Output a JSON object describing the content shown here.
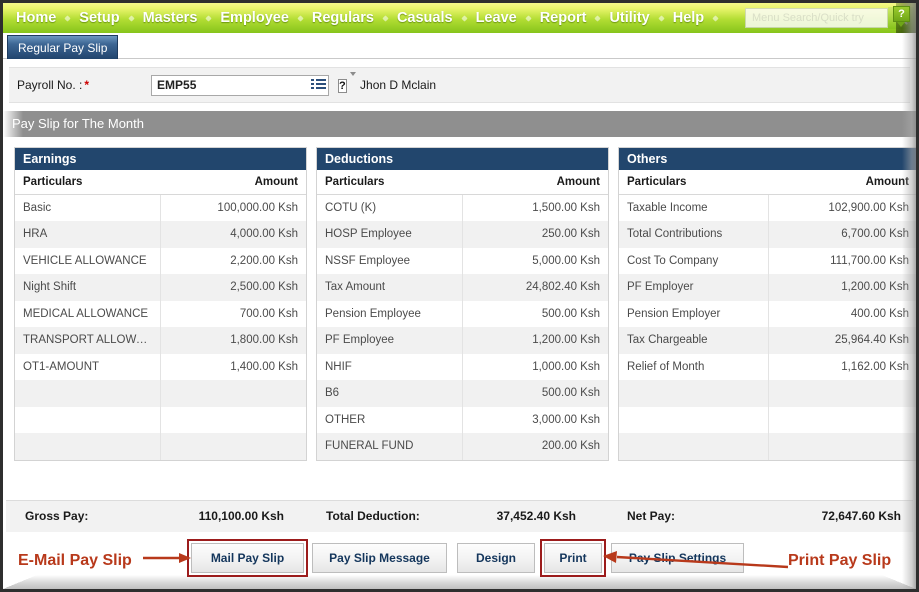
{
  "nav": {
    "items": [
      "Home",
      "Setup",
      "Masters",
      "Employee",
      "Regulars",
      "Casuals",
      "Leave",
      "Report",
      "Utility",
      "Help"
    ],
    "search_placeholder": "Menu Search/Quick try",
    "search_value": "",
    "search_icon": "magnifier-icon"
  },
  "tab": {
    "label": "Regular Pay Slip"
  },
  "help_badge": {
    "glyph": "?"
  },
  "payroll": {
    "label": "Payroll No. :",
    "required_mark": "*",
    "value": "EMP55",
    "picker_icon": "list-picker-icon",
    "help_glyph": "?",
    "employee_name": "Jhon D Mclain"
  },
  "section": {
    "title": "Pay Slip for The Month"
  },
  "columns": {
    "particulars": "Particulars",
    "amount": "Amount"
  },
  "panels": [
    {
      "title": "Earnings",
      "rows": [
        {
          "particular": "Basic",
          "amount": "100,000.00 Ksh"
        },
        {
          "particular": "HRA",
          "amount": "4,000.00 Ksh"
        },
        {
          "particular": "VEHICLE ALLOWANCE",
          "amount": "2,200.00 Ksh"
        },
        {
          "particular": "Night Shift",
          "amount": "2,500.00 Ksh"
        },
        {
          "particular": "MEDICAL ALLOWANCE",
          "amount": "700.00 Ksh"
        },
        {
          "particular": "TRANSPORT ALLOWANCE",
          "amount": "1,800.00 Ksh"
        },
        {
          "particular": "OT1-AMOUNT",
          "amount": "1,400.00 Ksh"
        },
        {
          "particular": "",
          "amount": ""
        },
        {
          "particular": "",
          "amount": ""
        },
        {
          "particular": "",
          "amount": ""
        }
      ]
    },
    {
      "title": "Deductions",
      "rows": [
        {
          "particular": "COTU (K)",
          "amount": "1,500.00 Ksh"
        },
        {
          "particular": "HOSP Employee",
          "amount": "250.00 Ksh"
        },
        {
          "particular": "NSSF Employee",
          "amount": "5,000.00 Ksh"
        },
        {
          "particular": "Tax Amount",
          "amount": "24,802.40 Ksh"
        },
        {
          "particular": "Pension Employee",
          "amount": "500.00 Ksh"
        },
        {
          "particular": "PF Employee",
          "amount": "1,200.00 Ksh"
        },
        {
          "particular": "NHIF",
          "amount": "1,000.00 Ksh"
        },
        {
          "particular": "B6",
          "amount": "500.00 Ksh"
        },
        {
          "particular": "OTHER",
          "amount": "3,000.00 Ksh"
        },
        {
          "particular": "FUNERAL FUND",
          "amount": "200.00 Ksh"
        }
      ]
    },
    {
      "title": "Others",
      "rows": [
        {
          "particular": "Taxable Income",
          "amount": "102,900.00 Ksh"
        },
        {
          "particular": "Total Contributions",
          "amount": "6,700.00 Ksh"
        },
        {
          "particular": "Cost To Company",
          "amount": "111,700.00 Ksh"
        },
        {
          "particular": "PF Employer",
          "amount": "1,200.00 Ksh"
        },
        {
          "particular": "Pension Employer",
          "amount": "400.00 Ksh"
        },
        {
          "particular": "Tax Chargeable",
          "amount": "25,964.40 Ksh"
        },
        {
          "particular": "Relief of Month",
          "amount": "1,162.00 Ksh"
        },
        {
          "particular": "",
          "amount": ""
        },
        {
          "particular": "",
          "amount": ""
        },
        {
          "particular": "",
          "amount": ""
        }
      ]
    }
  ],
  "totals": {
    "gross_label": "Gross Pay:",
    "gross_value": "110,100.00 Ksh",
    "deduction_label": "Total Deduction:",
    "deduction_value": "37,452.40 Ksh",
    "net_label": "Net Pay:",
    "net_value": "72,647.60 Ksh"
  },
  "buttons": {
    "mail": "Mail Pay Slip",
    "message": "Pay Slip Message",
    "design": "Design",
    "print": "Print",
    "settings": "Pay Slip Settings"
  },
  "annotations": {
    "email": "E-Mail Pay Slip",
    "print": "Print Pay Slip",
    "color": "#b8391b",
    "highlight_color": "#9c1c1c"
  }
}
